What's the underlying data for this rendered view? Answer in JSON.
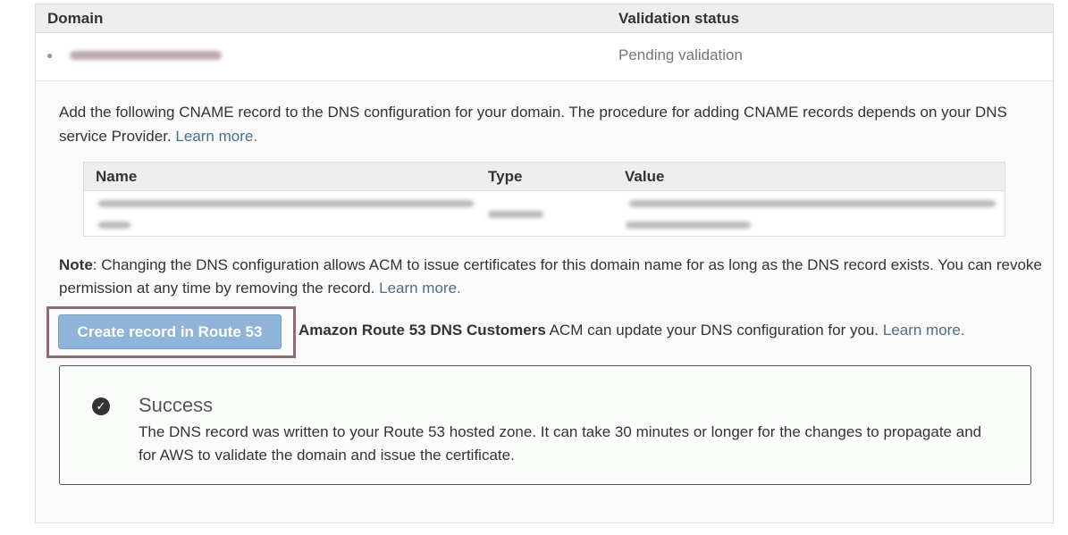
{
  "table": {
    "headers": {
      "domain": "Domain",
      "status": "Validation status"
    },
    "row": {
      "status": "Pending validation"
    }
  },
  "instructions": {
    "text": "Add the following CNAME record to the DNS configuration for your domain. The procedure for adding CNAME records depends on your DNS service Provider.",
    "learn_more": "Learn more."
  },
  "cname_table": {
    "headers": {
      "name": "Name",
      "type": "Type",
      "value": "Value"
    }
  },
  "note": {
    "label": "Note",
    "text": ": Changing the DNS configuration allows ACM to issue certificates for this domain name for as long as the DNS record exists. You can revoke permission at any time by removing the record.",
    "learn_more": "Learn more."
  },
  "route53": {
    "button_label": "Create record in Route 53",
    "customers_label": "Amazon Route 53 DNS Customers",
    "text": "ACM can update your DNS configuration for you.",
    "learn_more": "Learn more."
  },
  "success": {
    "title": "Success",
    "message": "The DNS record was written to your Route 53 hosted zone. It can take 30 minutes or longer for the changes to propagate and for AWS to validate the domain and issue the certificate."
  }
}
